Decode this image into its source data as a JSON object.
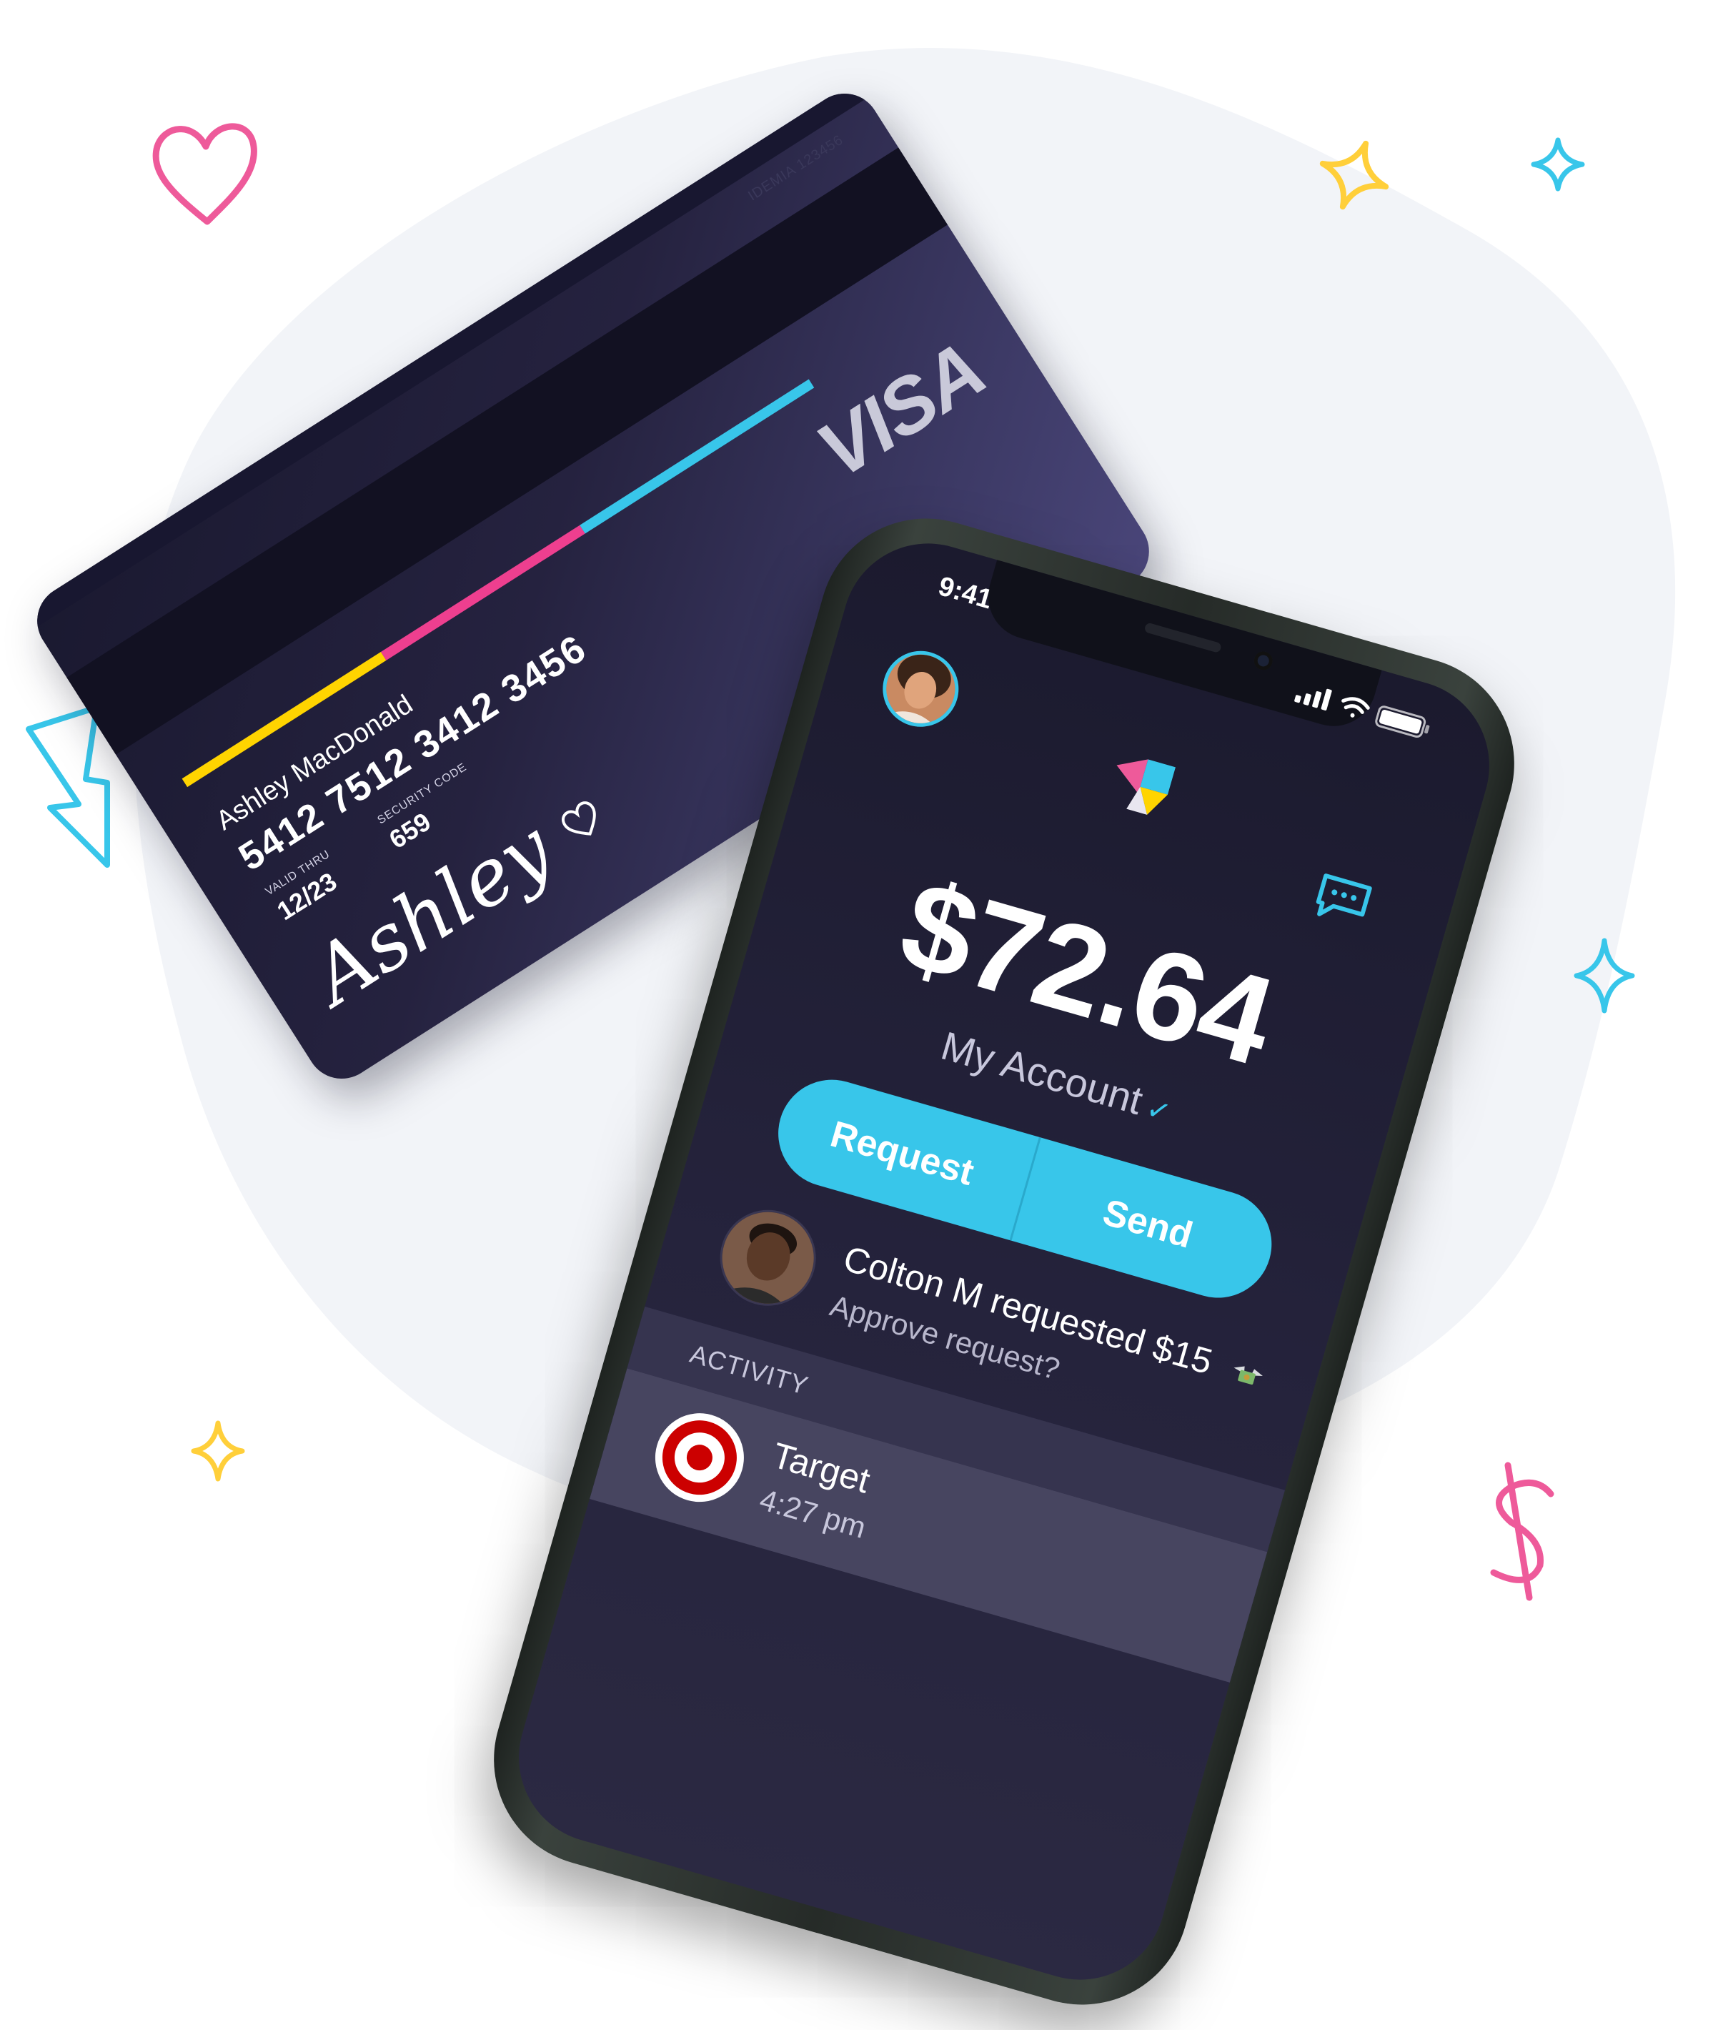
{
  "card": {
    "issuer_code": "IDEMIA 123456",
    "brand": "VISA",
    "holder_name": "Ashley MacDonald",
    "number": "5412 7512 3412 3456",
    "valid_thru_label": "VALID THRU",
    "valid_thru": "12/23",
    "security_code_label": "SECURITY CODE",
    "security_code": "659",
    "signature": "Ashley",
    "stripe_colors": [
      "#ffd400",
      "#ee3f8f",
      "#38c6ea"
    ]
  },
  "phone": {
    "status_bar": {
      "time": "9:41",
      "icons": [
        "signal-icon",
        "wifi-icon",
        "battery-icon"
      ]
    },
    "header": {
      "avatar": "user-avatar",
      "logo": "app-logo",
      "chat": "chat-icon"
    },
    "balance": "$72.64",
    "account_label": "My Account",
    "actions": {
      "request_label": "Request",
      "send_label": "Send"
    },
    "request_notice": {
      "title": "Colton M requested $15",
      "subtitle": "Approve request?"
    },
    "activity": {
      "header": "ACTIVITY",
      "items": [
        {
          "name": "Target",
          "time": "4:27 pm",
          "icon": "target-logo-icon"
        }
      ]
    }
  },
  "colors": {
    "accent": "#38c6ea",
    "pink": "#ee3f8f",
    "yellow": "#ffd400",
    "screen_bg": "#1b1a2e"
  }
}
